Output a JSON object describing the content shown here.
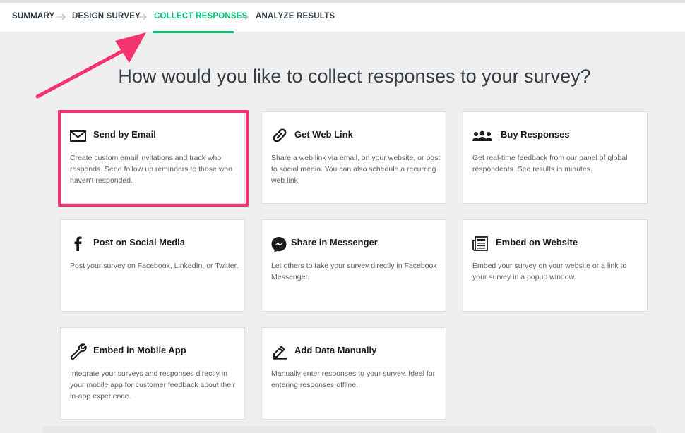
{
  "steps": [
    {
      "label": "SUMMARY"
    },
    {
      "label": "DESIGN SURVEY"
    },
    {
      "label": "COLLECT RESPONSES"
    },
    {
      "label": "ANALYZE RESULTS"
    }
  ],
  "active_step": "COLLECT RESPONSES",
  "headline": "How would you like to collect responses to your survey?",
  "cards": [
    {
      "title": "Send by Email",
      "icon": "envelope-icon",
      "desc": "Create custom email invitations and track who responds. Send follow up reminders to those who haven't responded."
    },
    {
      "title": "Get Web Link",
      "icon": "link-icon",
      "desc": "Share a web link via email, on your website, or post to social media. You can also schedule a recurring web link."
    },
    {
      "title": "Buy Responses",
      "icon": "people-icon",
      "desc": "Get real-time feedback from our panel of global respondents. See results in minutes."
    },
    {
      "title": "Post on Social Media",
      "icon": "facebook-icon",
      "desc": "Post your survey on Facebook, LinkedIn, or Twitter."
    },
    {
      "title": "Share in Messenger",
      "icon": "messenger-icon",
      "desc": "Let others to take your survey directly in Facebook Messenger."
    },
    {
      "title": "Embed on Website",
      "icon": "newspaper-icon",
      "desc": "Embed your survey on your website or a link to your survey in a popup window."
    },
    {
      "title": "Embed in Mobile App",
      "icon": "wrench-icon",
      "desc": "Integrate your surveys and responses directly in your mobile app for customer feedback about their in-app experience."
    },
    {
      "title": "Add Data Manually",
      "icon": "pencil-icon",
      "desc": "Manually enter responses to your survey. Ideal for entering responses offline."
    }
  ],
  "colors": {
    "accent": "#00bf6f",
    "annotation": "#f2336e",
    "text": "#333e48",
    "background": "#efefef"
  }
}
